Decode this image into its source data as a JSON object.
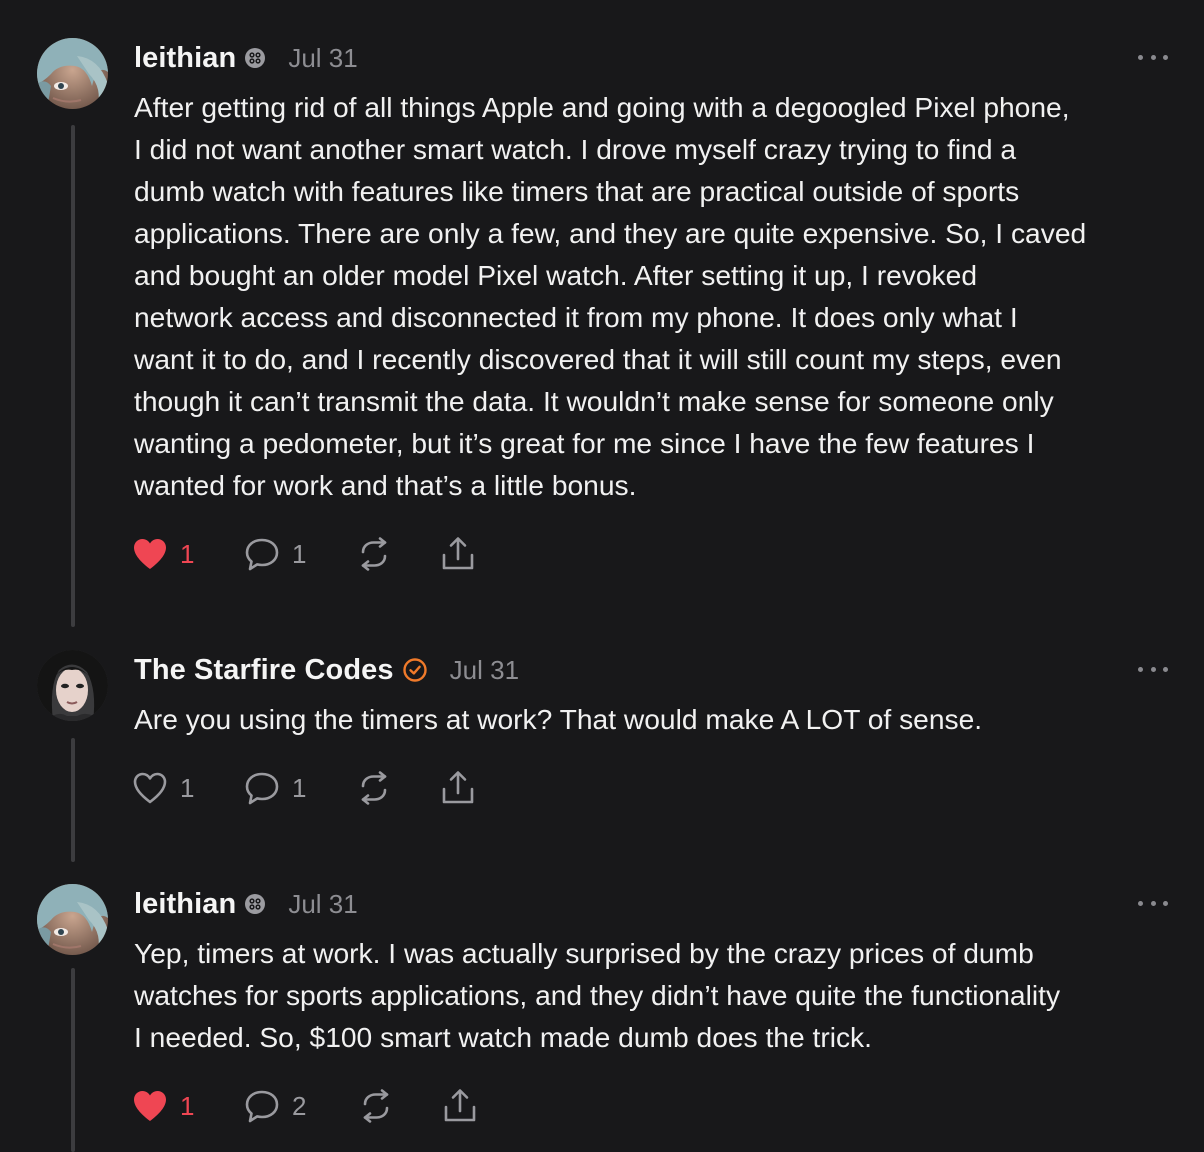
{
  "comments": [
    {
      "username": "leithian",
      "badge": "profile-badge-icon",
      "date": "Jul 31",
      "text": "After getting rid of all things Apple and going with a degoogled Pixel phone,\nI did not want another smart watch. I drove myself crazy trying to find a\ndumb watch with features like timers that are practical outside of sports\napplications. There are only a few, and they are quite expensive. So, I caved\nand bought an older model Pixel watch. After setting it up, I revoked\nnetwork access and disconnected it from my phone. It does only what I\nwant it to do, and I recently discovered that it will still count my steps, even\nthough it can’t transmit the data. It wouldn’t make sense for someone only\nwanting a pedometer, but it’s great for me since I have the few features I\nwanted for work and that’s a little bonus.",
      "liked": true,
      "likes": "1",
      "replies": "1"
    },
    {
      "username": "The Starfire Codes",
      "badge": "verified-badge-icon",
      "date": "Jul 31",
      "text": "Are you using the timers at work? That would make A LOT of sense.",
      "liked": false,
      "likes": "1",
      "replies": "1"
    },
    {
      "username": "leithian",
      "badge": "profile-badge-icon",
      "date": "Jul 31",
      "text": "Yep, timers at work. I was actually surprised by the crazy prices of dumb\nwatches for sports applications, and they didn’t have quite the functionality\nI needed. So, $100 smart watch made dumb does the trick.",
      "liked": true,
      "likes": "1",
      "replies": "2"
    }
  ],
  "colors": {
    "background": "#18181a",
    "like_active": "#ef4653",
    "verified": "#f07a2a",
    "muted": "#8d8d92"
  }
}
